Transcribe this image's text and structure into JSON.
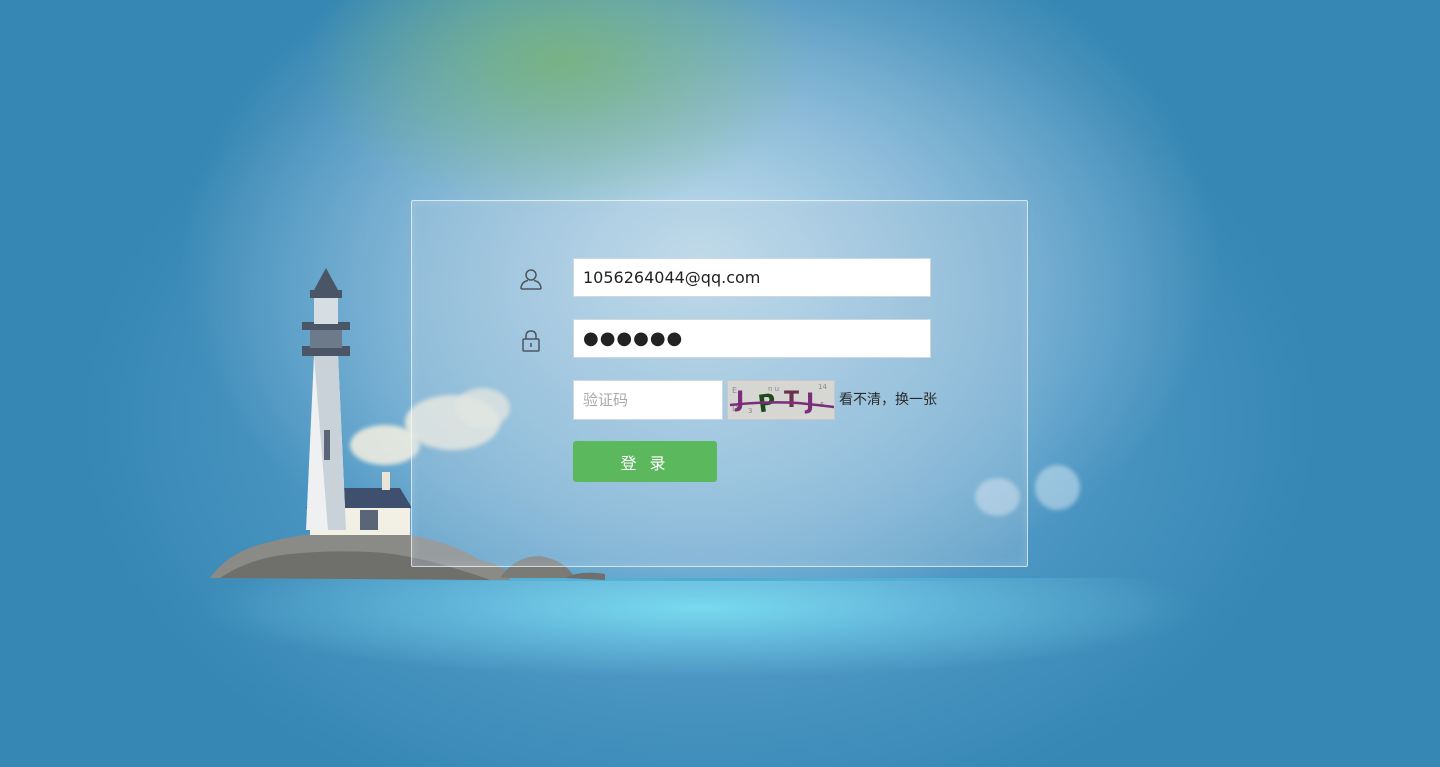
{
  "login": {
    "username_value": "1056264044@qq.com",
    "password_masked": "●●●●●●",
    "captcha_placeholder": "验证码",
    "captcha_text": "JPTJ",
    "refresh_label": "看不清，换一张",
    "submit_label": "登 录"
  },
  "icons": {
    "user": "user-icon",
    "lock": "lock-icon"
  },
  "colors": {
    "background": "#3687b4",
    "button": "#5cb85c",
    "panel_border": "#ffffff"
  }
}
